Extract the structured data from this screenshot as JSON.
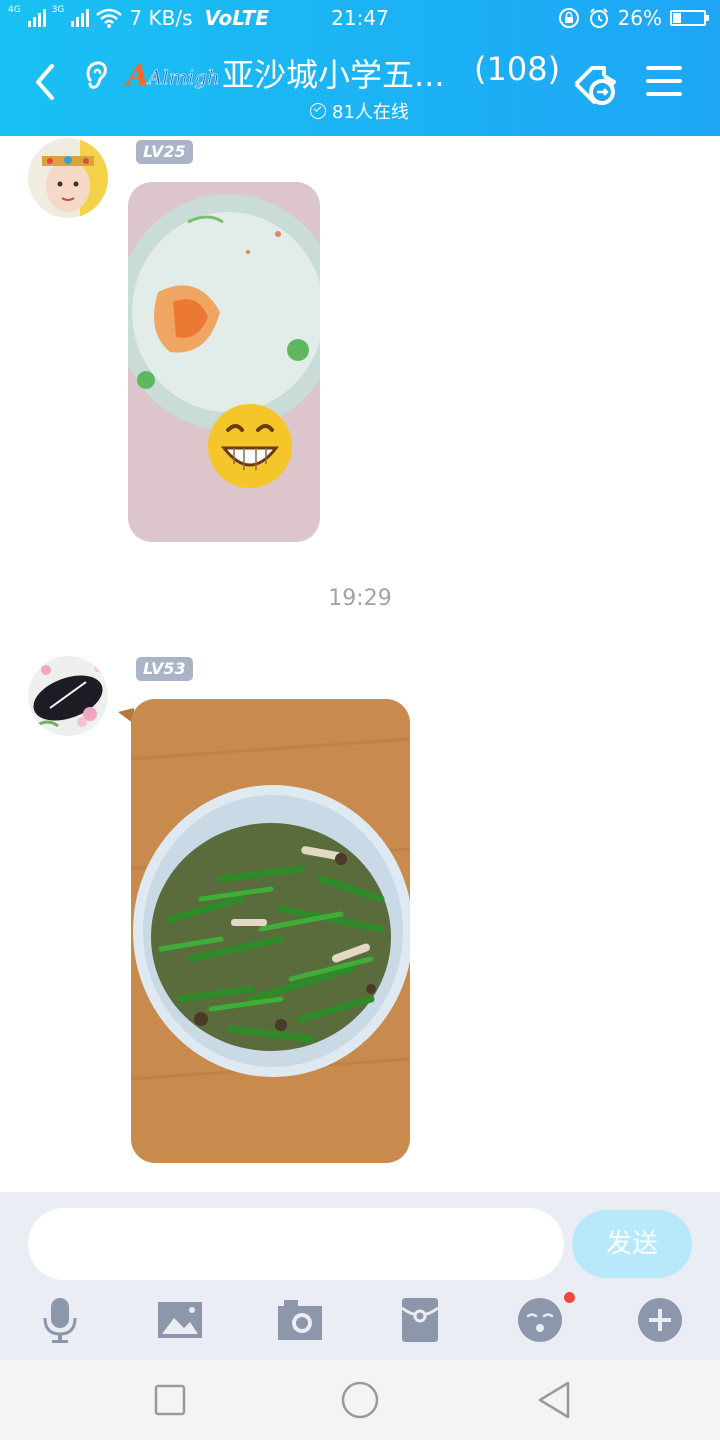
{
  "status_bar": {
    "net1": "4G",
    "net2": "3G",
    "speed": "7 KB/s",
    "volte": "VoLTE",
    "time": "21:47",
    "battery_text": "26%",
    "battery_level": 0.26
  },
  "header": {
    "brand_text": "Almighty",
    "title": "亚沙城小学五...",
    "member_count": "(108)",
    "online": "81人在线"
  },
  "chat": {
    "messages": [
      {
        "level": "LV25",
        "type": "image",
        "icon": "image-icon"
      },
      {
        "timestamp": "19:29"
      },
      {
        "level": "LV53",
        "type": "image",
        "icon": "image-icon"
      }
    ]
  },
  "input": {
    "placeholder": "",
    "send_label": "发送"
  },
  "toolbar": {
    "items": [
      "voice-icon",
      "picture-icon",
      "camera-icon",
      "red-packet-icon",
      "emoji-icon",
      "plus-icon"
    ],
    "emoji_has_badge": true
  },
  "colors": {
    "header": "#1ea6f5",
    "level_badge": "#aab3c8",
    "send_button": "#b7e9fb",
    "badge_dot": "#f04a3c"
  }
}
